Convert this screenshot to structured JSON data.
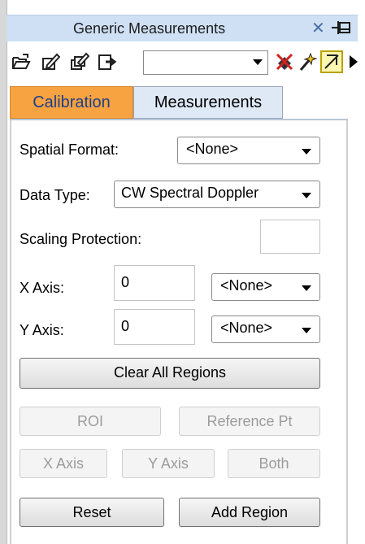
{
  "window": {
    "title": "Generic Measurements",
    "close_glyph": "✕",
    "pin_icon": "pin-icon"
  },
  "toolbar": {
    "icons": [
      "open-folder-icon",
      "edit-region-icon",
      "edit-multiple-icon",
      "export-icon"
    ],
    "combo_value": "",
    "right_icons": [
      "eraser-icon",
      "wand-icon",
      "yellow-box-icon",
      "arrow-right-icon"
    ]
  },
  "tabs": [
    {
      "label": "Calibration",
      "active": true
    },
    {
      "label": "Measurements",
      "active": false
    }
  ],
  "form": {
    "spatial_format_label": "Spatial Format:",
    "spatial_format_value": "<None>",
    "data_type_label": "Data Type:",
    "data_type_value": "CW Spectral Doppler",
    "scaling_protection_label": "Scaling Protection:",
    "scaling_protection_value": "",
    "x_axis_label": "X Axis:",
    "x_axis_value": "0",
    "x_axis_unit": "<None>",
    "y_axis_label": "Y Axis:",
    "y_axis_value": "0",
    "y_axis_unit": "<None>"
  },
  "buttons": {
    "clear_all": "Clear All Regions",
    "roi": "ROI",
    "reference_pt": "Reference Pt",
    "x_axis": "X Axis",
    "y_axis": "Y Axis",
    "both": "Both",
    "reset": "Reset",
    "add_region": "Add Region"
  }
}
